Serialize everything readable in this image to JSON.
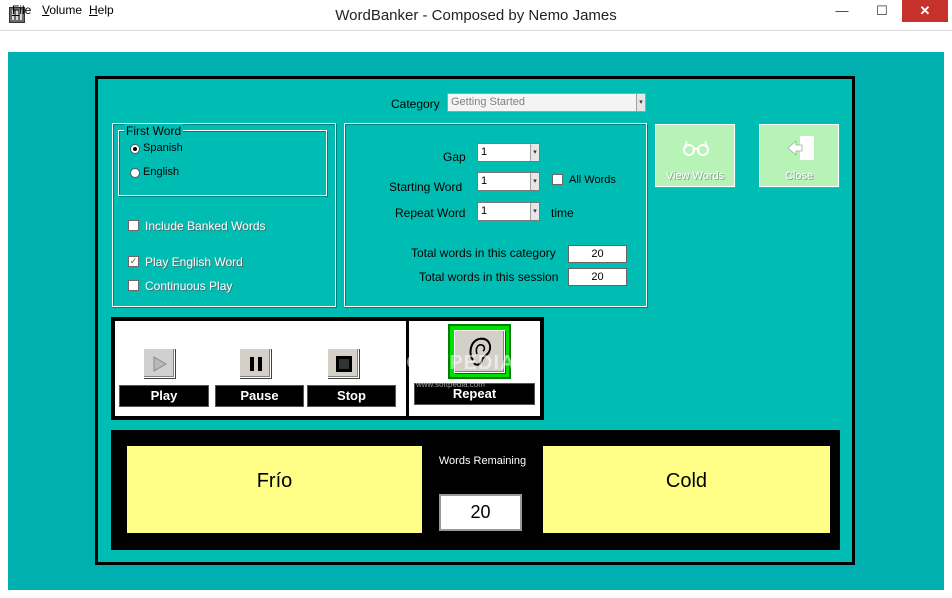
{
  "window": {
    "title": "WordBanker - Composed by Nemo James",
    "minimize_glyph": "—",
    "maximize_glyph": "☐",
    "close_glyph": "✕"
  },
  "menu": [
    {
      "label": "File",
      "key": "F"
    },
    {
      "label": "Volume",
      "key": "V"
    },
    {
      "label": "Help",
      "key": "H"
    }
  ],
  "category": {
    "label": "Category",
    "value": "Getting Started"
  },
  "first_word": {
    "legend": "First Word",
    "options": [
      {
        "label": "Spanish",
        "selected": true
      },
      {
        "label": "English",
        "selected": false
      }
    ]
  },
  "options": {
    "include_banked": {
      "label": "Include Banked Words",
      "checked": false
    },
    "play_english": {
      "label": "Play English Word",
      "checked": true
    },
    "continuous_play": {
      "label": "Continuous Play",
      "checked": false
    }
  },
  "settings": {
    "gap": {
      "label": "Gap",
      "value": "1"
    },
    "starting_word": {
      "label": "Starting Word",
      "value": "1"
    },
    "all_words": {
      "label": "All Words",
      "checked": false
    },
    "repeat_word": {
      "label": "Repeat Word",
      "value": "1",
      "suffix": "time"
    },
    "total_category": {
      "label": "Total words in this category",
      "value": "20"
    },
    "total_session": {
      "label": "Total words in this session",
      "value": "20"
    }
  },
  "buttons": {
    "view_words": "View Words",
    "close": "Close",
    "play": "Play",
    "pause": "Pause",
    "stop": "Stop",
    "repeat": "Repeat"
  },
  "watermark": {
    "big": "SOFTPEDIA",
    "small": "www.softpedia.com"
  },
  "display": {
    "spanish_word": "Frío",
    "english_word": "Cold",
    "words_remaining_label": "Words Remaining",
    "words_remaining": "20"
  },
  "colors": {
    "client_bg": "#00b0b0",
    "frame_bg": "#00bdb4",
    "word_bg": "#ffff88",
    "repeat_highlight": "#00ff00",
    "close_button": "#c7312b"
  }
}
